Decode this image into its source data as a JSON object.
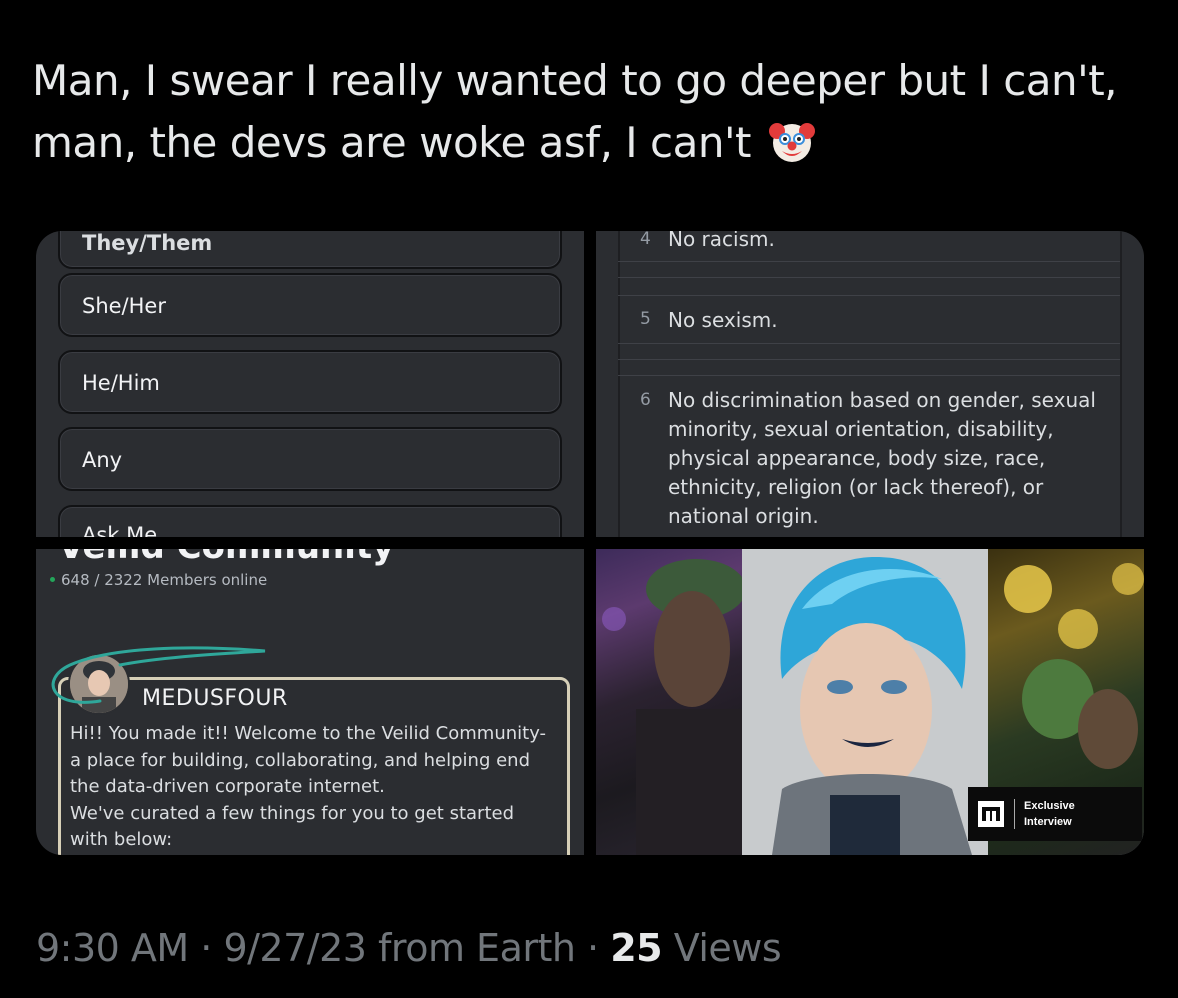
{
  "tweet": {
    "text_line1": "Man, I swear I really wanted to go deeper but I can't,",
    "text_line2": "man, the devs are woke asf, I can't",
    "emoji": "clown-face-emoji"
  },
  "pronouns_panel": {
    "cut_top": "They/Them",
    "options": [
      "She/Her",
      "He/Him",
      "Any"
    ],
    "cut_bottom": "Ask Me"
  },
  "rules_panel": {
    "rules": [
      {
        "num": "4",
        "text": "No racism."
      },
      {
        "num": "5",
        "text": "No sexism."
      },
      {
        "num": "6",
        "text": "No discrimination based on gender, sexual minority, sexual orientation, disability, physical appearance, body size, race, ethnicity, religion (or lack thereof), or national origin."
      }
    ]
  },
  "community_panel": {
    "title": "Veilid Community",
    "online": "648 / 2322 Members online",
    "author": "MEDUSFOUR",
    "message": "Hi!! You made it!! Welcome to the Veilid Community- a place for building, collaborating, and helping end the data-driven corporate internet.\nWe've curated a few things for you to get started with below:"
  },
  "photo_panel": {
    "badge_line1": "Exclusive",
    "badge_line2": "Interview"
  },
  "meta": {
    "time": "9:30 AM",
    "date": "9/27/23",
    "from": "from Earth",
    "views_count": "25",
    "views_label": "Views"
  },
  "colors": {
    "background": "#000000",
    "discord_bg": "#2b2d31",
    "accent_blue": "#1d9bf0",
    "online_green": "#23a55a"
  }
}
